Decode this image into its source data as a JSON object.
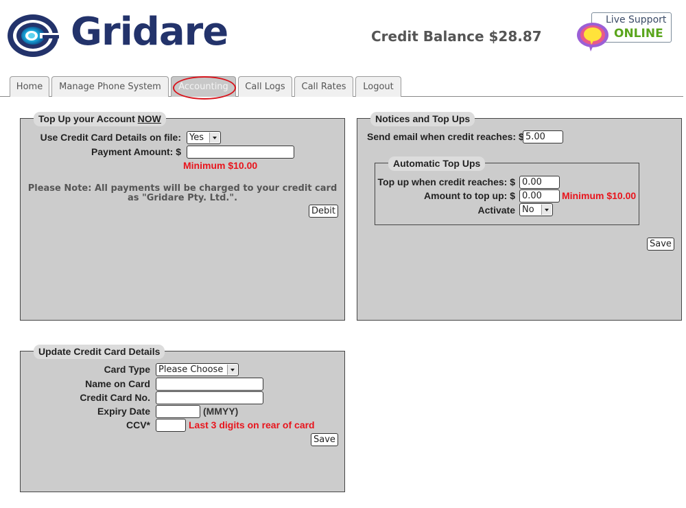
{
  "header": {
    "brand": "Gridare",
    "credit_balance": "Credit Balance $28.87",
    "live_support": {
      "line1": "Live Support",
      "status": "ONLINE"
    }
  },
  "tabs": [
    {
      "label": "Home",
      "active": false
    },
    {
      "label": "Manage Phone System",
      "active": false
    },
    {
      "label": "Accounting",
      "active": true
    },
    {
      "label": "Call Logs",
      "active": false
    },
    {
      "label": "Call Rates",
      "active": false
    },
    {
      "label": "Logout",
      "active": false
    }
  ],
  "topup": {
    "title": "Top Up your Account ",
    "title_emph": "NOW",
    "use_card_label": "Use Credit Card Details on file:",
    "use_card_value": "Yes",
    "payment_label": "Payment Amount: $",
    "payment_value": "",
    "minimum": "Minimum $10.00",
    "note_line1": "Please Note: All payments will be charged to your credit card",
    "note_line2": "as \"Gridare Pty. Ltd.\".",
    "debit_button": "Debit"
  },
  "notices": {
    "title": "Notices and Top Ups",
    "email_label": "Send email when credit reaches: $",
    "email_value": "5.00",
    "auto": {
      "title": "Automatic Top Ups",
      "topup_when_label": "Top up when credit reaches: $",
      "topup_when_value": "0.00",
      "amount_label": "Amount to top up: $",
      "amount_value": "0.00",
      "minimum": "Minimum $10.00",
      "activate_label": "Activate",
      "activate_value": "No"
    },
    "save_button": "Save"
  },
  "card": {
    "title": "Update Credit Card Details",
    "type_label": "Card Type",
    "type_value": "Please Choose",
    "name_label": "Name on Card",
    "name_value": "",
    "number_label": "Credit Card No.",
    "number_value": "",
    "expiry_label": "Expiry Date",
    "expiry_value": "",
    "expiry_hint": "(MMYY)",
    "ccv_label": "CCV*",
    "ccv_value": "",
    "ccv_hint": "Last 3 digits on rear of card",
    "save_button": "Save"
  }
}
